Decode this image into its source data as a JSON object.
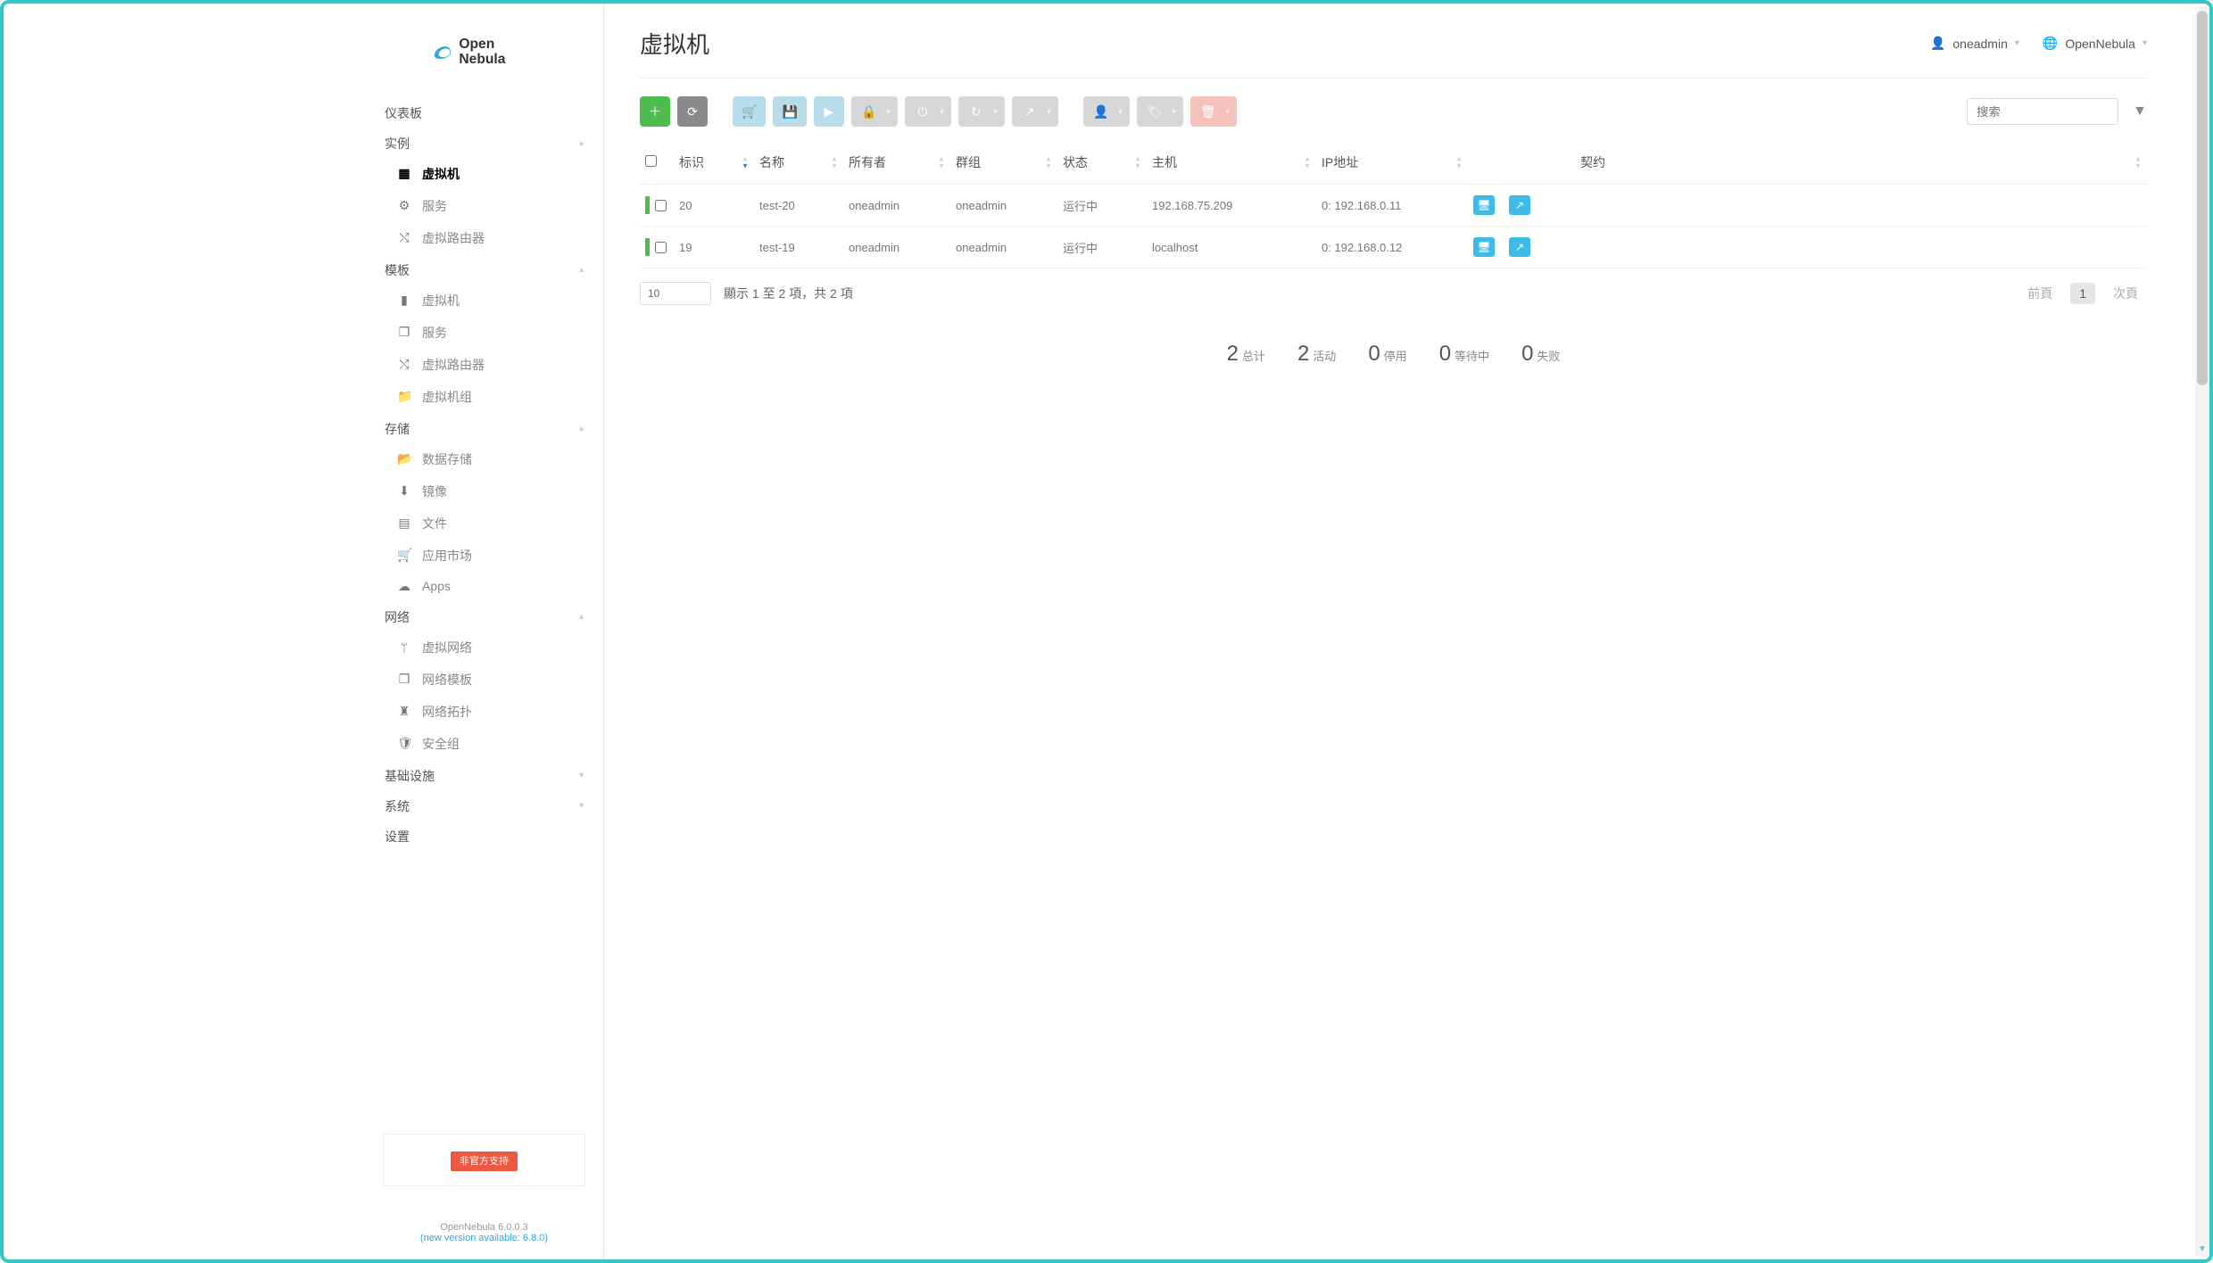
{
  "brand": {
    "name1": "Open",
    "name2": "Nebula"
  },
  "header": {
    "title": "虚拟机",
    "user": "oneadmin",
    "zone": "OpenNebula"
  },
  "sidebar": {
    "dashboard": "仪表板",
    "instances": {
      "title": "实例",
      "vm": "虚拟机",
      "services": "服务",
      "vrouters": "虚拟路由器"
    },
    "templates": {
      "title": "模板",
      "vm": "虚拟机",
      "services": "服务",
      "vrouters": "虚拟路由器",
      "vmgroups": "虚拟机组"
    },
    "storage": {
      "title": "存储",
      "datastores": "数据存储",
      "images": "镜像",
      "files": "文件",
      "market": "应用市场",
      "apps": "Apps"
    },
    "network": {
      "title": "网络",
      "vnets": "虚拟网络",
      "vnet_tpl": "网络模板",
      "topo": "网络拓扑",
      "secgroups": "安全组"
    },
    "infra_title": "基础设施",
    "system_title": "系统",
    "settings_title": "设置",
    "support_badge": "非官方支持",
    "version": "OpenNebula 6.0.0.3",
    "update": "(new version available: 6.8.0)"
  },
  "search": {
    "placeholder": "搜索"
  },
  "table": {
    "headers": {
      "id": "标识",
      "name": "名称",
      "owner": "所有者",
      "group": "群组",
      "status": "状态",
      "host": "主机",
      "ip": "IP地址",
      "charter": "契约"
    },
    "rows": [
      {
        "id": "20",
        "name": "test-20",
        "owner": "oneadmin",
        "group": "oneadmin",
        "status": "运行中",
        "host": "192.168.75.209",
        "ip": "0: 192.168.0.11"
      },
      {
        "id": "19",
        "name": "test-19",
        "owner": "oneadmin",
        "group": "oneadmin",
        "status": "运行中",
        "host": "localhost",
        "ip": "0: 192.168.0.12"
      }
    ],
    "pagesize": "10",
    "showing": "顯示 1 至 2 項，共 2 項",
    "prev": "前頁",
    "page1": "1",
    "next": "次頁"
  },
  "summary": {
    "total_n": "2",
    "total_l": "总计",
    "active_n": "2",
    "active_l": "活动",
    "off_n": "0",
    "off_l": "停用",
    "pending_n": "0",
    "pending_l": "等待中",
    "failed_n": "0",
    "failed_l": "失败"
  }
}
